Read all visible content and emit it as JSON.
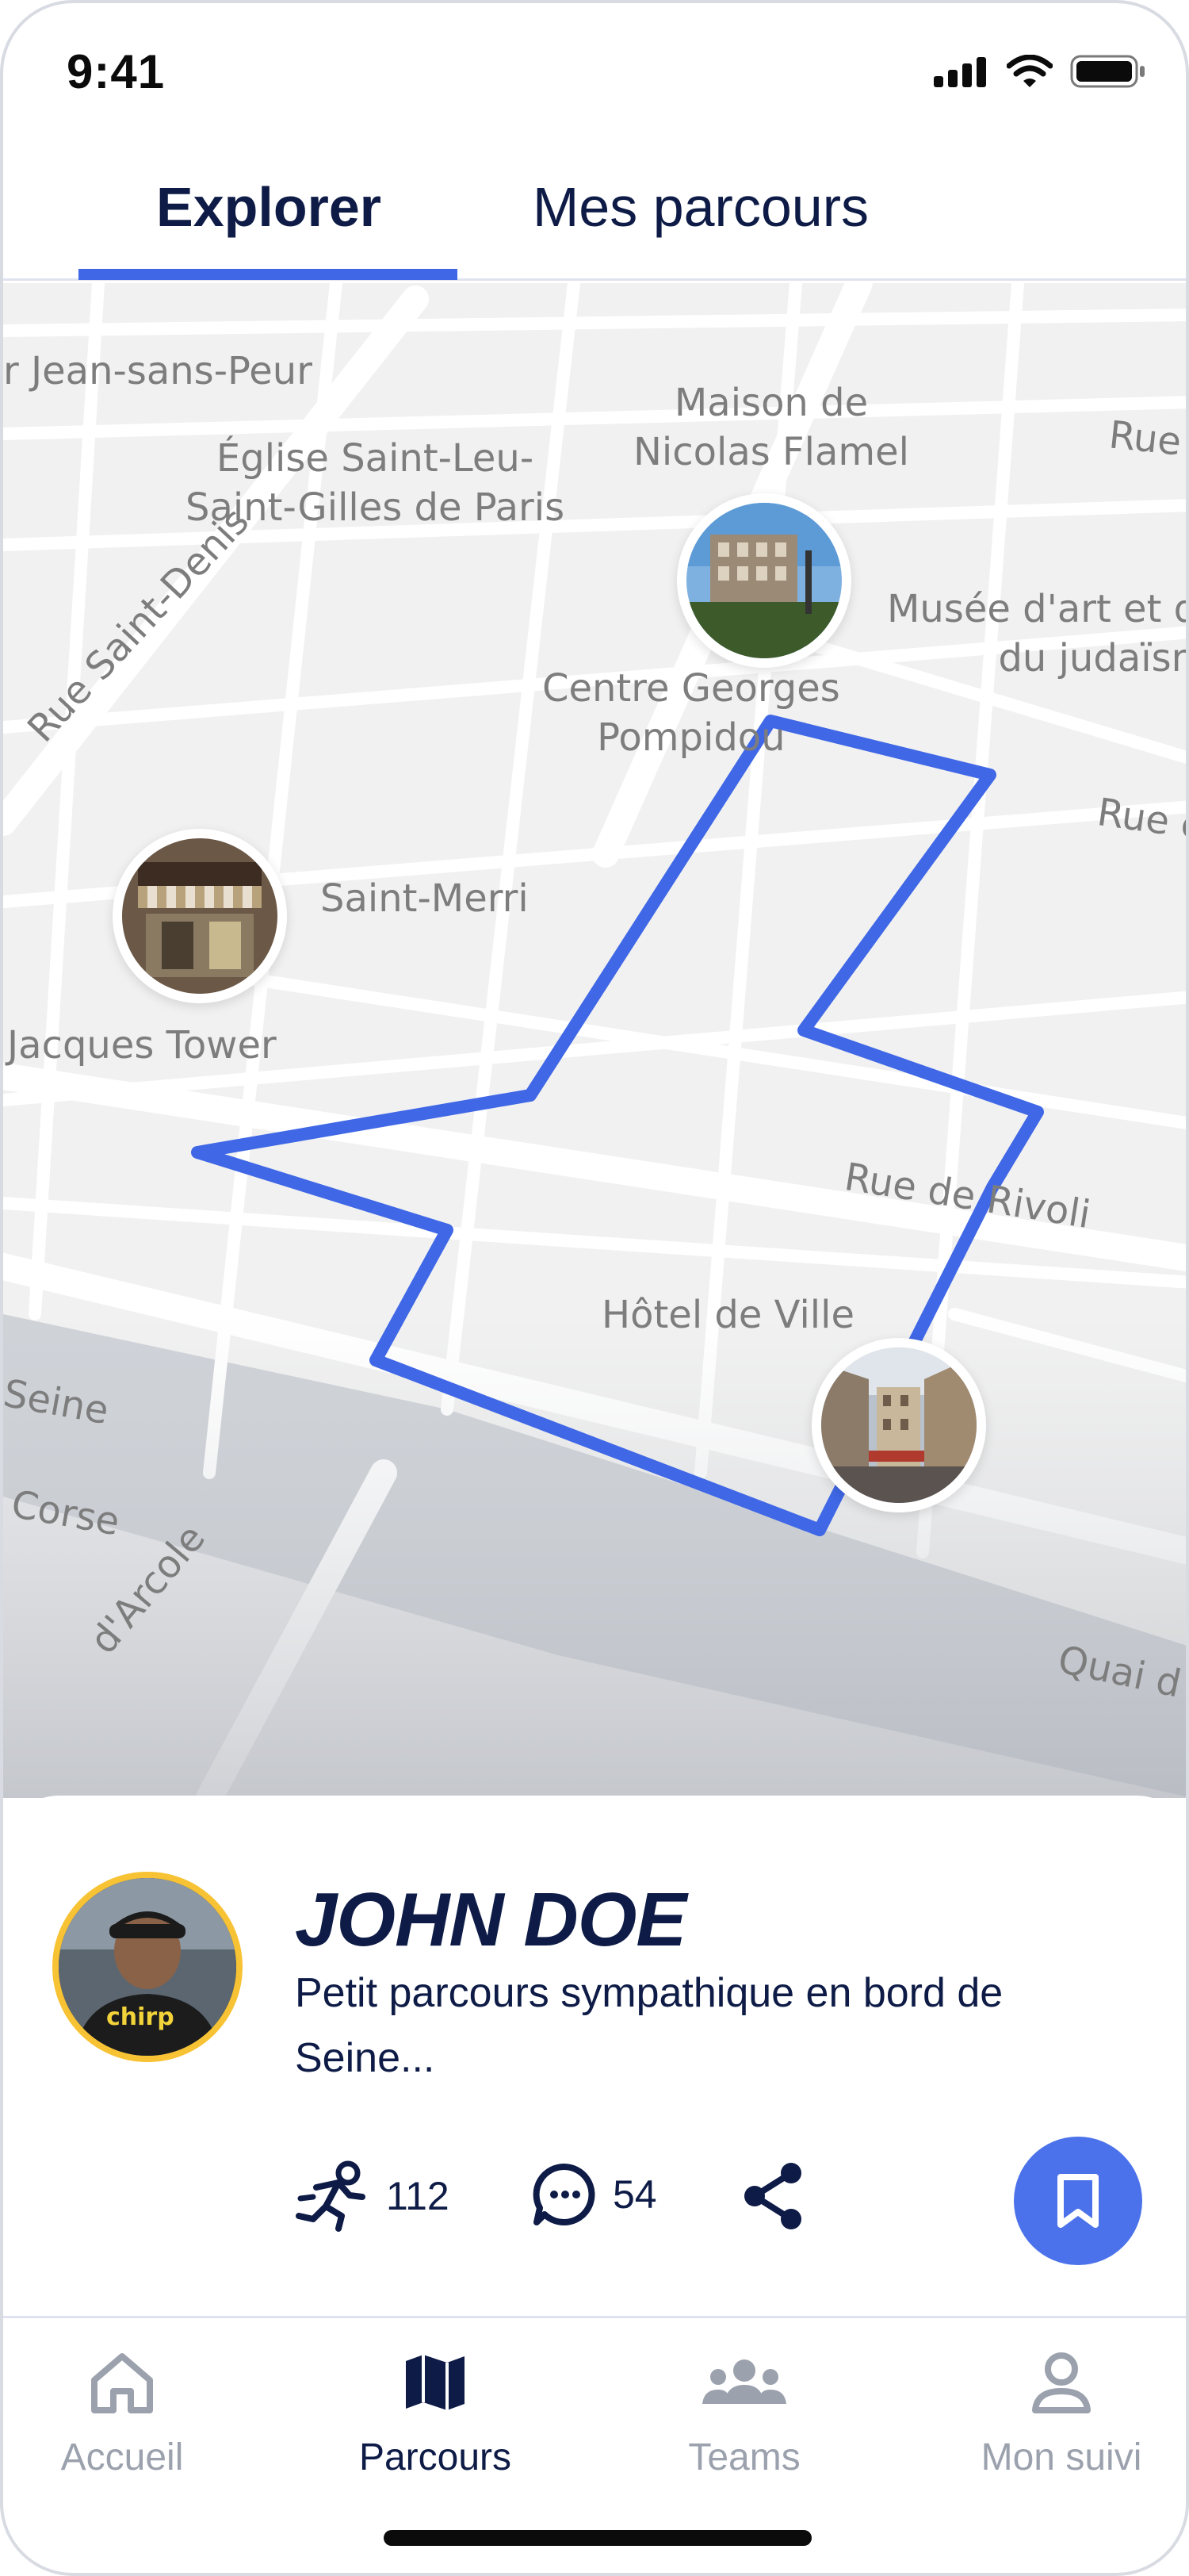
{
  "status_bar": {
    "time": "9:41"
  },
  "tabs": [
    {
      "label": "Explorer",
      "active": true
    },
    {
      "label": "Mes parcours",
      "active": false
    }
  ],
  "map": {
    "labels": {
      "l0": "r Jean-sans-Peur",
      "l1": "Église Saint-Leu-\nSaint-Gilles de Paris",
      "l2": "Maison de\nNicolas Flamel",
      "l3": "Rue",
      "l4": "Musée d'art et d'\ndu judaïsm",
      "l5": "Rue Saint-Denis",
      "l6": "Centre Georges\nPompidou",
      "l7": "Rue c",
      "l8": "Saint-Merri",
      "l9": "Jacques Tower",
      "l10": "Rue de Rivoli",
      "l11": "Hôtel de Ville",
      "l12": "Seine",
      "l13": "Corse",
      "l14": "d'Arcole",
      "l15": "Quai d"
    },
    "route_color": "#3f67e6",
    "accent": "#3f67e6"
  },
  "card": {
    "author": "JOHN DOE",
    "description": "Petit parcours sympathique en bord de Seine...",
    "runs": "112",
    "comments": "54"
  },
  "icons": {
    "runner": "runner-icon",
    "comment": "comment-icon",
    "share": "share-icon",
    "bookmark": "bookmark-icon"
  },
  "nav": [
    {
      "label": "Accueil",
      "icon": "home-icon",
      "active": false
    },
    {
      "label": "Parcours",
      "icon": "map-icon",
      "active": true
    },
    {
      "label": "Teams",
      "icon": "teams-icon",
      "active": false
    },
    {
      "label": "Mon suivi",
      "icon": "user-icon",
      "active": false
    }
  ]
}
